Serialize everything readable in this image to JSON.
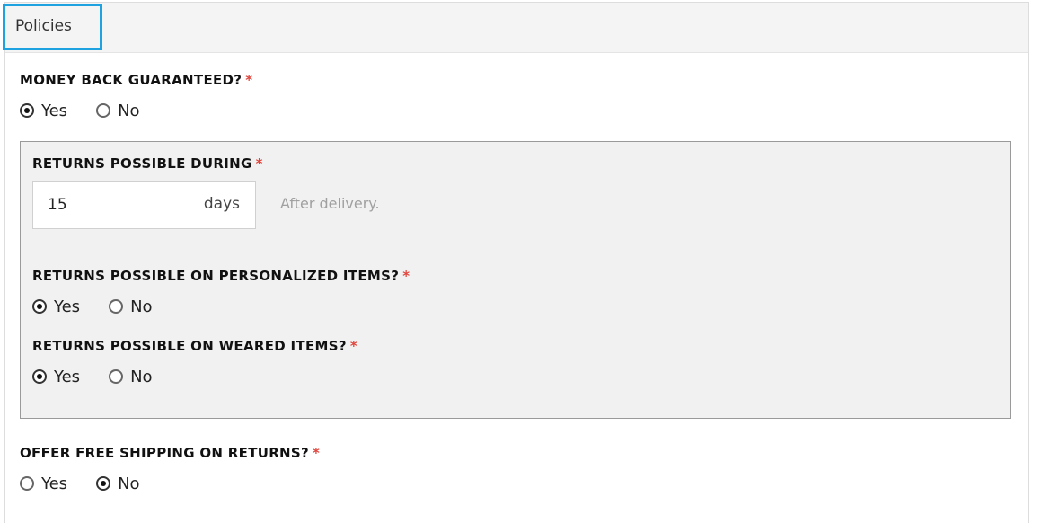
{
  "tab": {
    "label": "Policies"
  },
  "required_mark": "*",
  "money_back": {
    "label": "MONEY BACK GUARANTEED?",
    "options": {
      "yes": "Yes",
      "no": "No"
    },
    "selected": "Yes"
  },
  "returns_during": {
    "label": "RETURNS POSSIBLE DURING",
    "value": "15",
    "unit": "days",
    "hint": "After delivery."
  },
  "personalized": {
    "label": "RETURNS POSSIBLE ON PERSONALIZED ITEMS?",
    "options": {
      "yes": "Yes",
      "no": "No"
    },
    "selected": "Yes"
  },
  "weared": {
    "label": "RETURNS POSSIBLE ON WEARED ITEMS?",
    "options": {
      "yes": "Yes",
      "no": "No"
    },
    "selected": "Yes"
  },
  "free_shipping": {
    "label": "OFFER FREE SHIPPING ON RETURNS?",
    "options": {
      "yes": "Yes",
      "no": "No"
    },
    "selected": "No"
  },
  "colors": {
    "tab_border": "#1ea2e0",
    "required": "#e0463e",
    "box_bg": "#f1f1f1"
  }
}
